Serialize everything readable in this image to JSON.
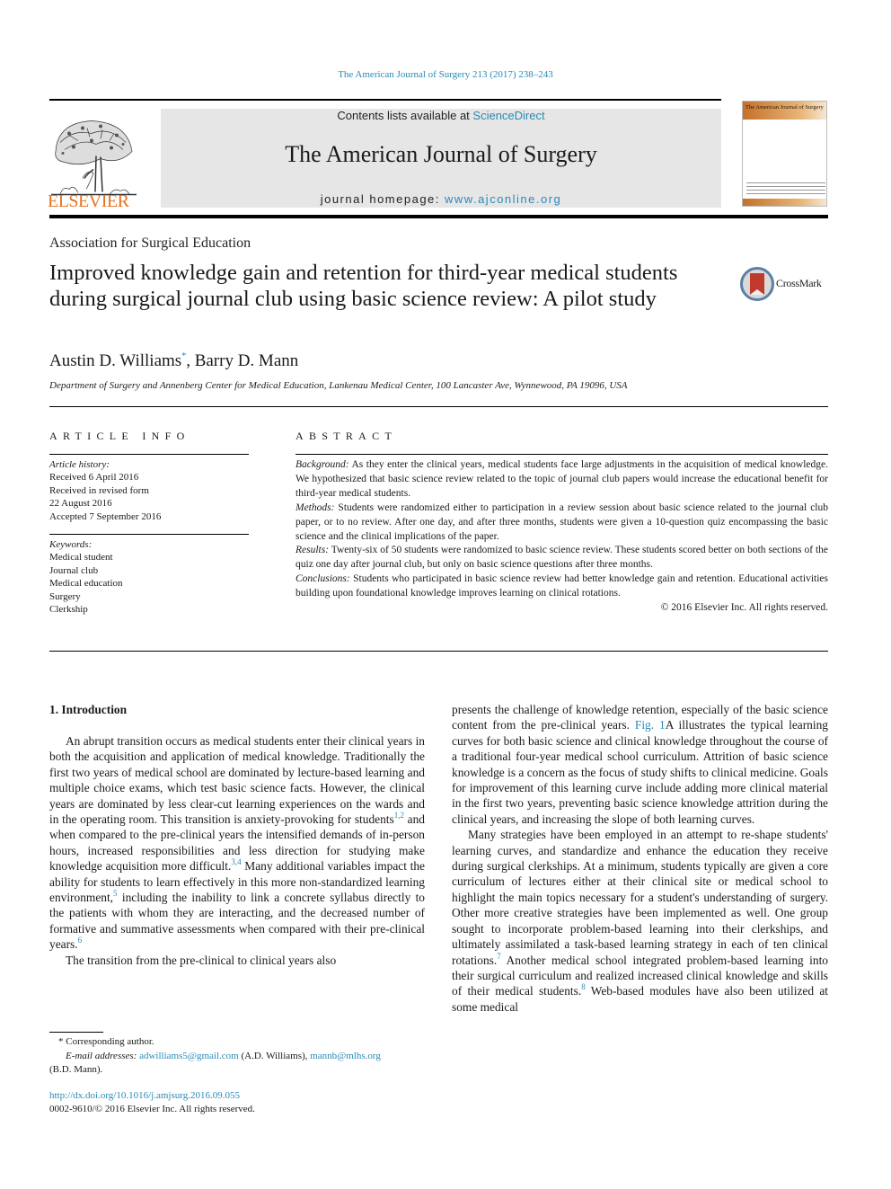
{
  "citation": "The American Journal of Surgery 213 (2017) 238–243",
  "masthead": {
    "publisher": "ELSEVIER",
    "contents_prefix": "Contents lists available at ",
    "contents_link": "ScienceDirect",
    "journal_name": "The American Journal of Surgery",
    "homepage_prefix": "journal homepage: ",
    "homepage_link": "www.ajconline.org",
    "cover_title": "The American Journal of Surgery"
  },
  "section_label": "Association for Surgical Education",
  "title": "Improved knowledge gain and retention for third-year medical students during surgical journal club using basic science review: A pilot study",
  "crossmark_label": "CrossMark",
  "authors": [
    {
      "name": "Austin D. Williams",
      "mark": "*"
    },
    {
      "name": "Barry D. Mann"
    }
  ],
  "affiliation": "Department of Surgery and Annenberg Center for Medical Education, Lankenau Medical Center, 100 Lancaster Ave, Wynnewood, PA 19096, USA",
  "article_info": {
    "heading": "ARTICLE INFO",
    "history_label": "Article history:",
    "history": [
      "Received 6 April 2016",
      "Received in revised form",
      "22 August 2016",
      "Accepted 7 September 2016"
    ],
    "keywords_label": "Keywords:",
    "keywords": [
      "Medical student",
      "Journal club",
      "Medical education",
      "Surgery",
      "Clerkship"
    ]
  },
  "abstract": {
    "heading": "ABSTRACT",
    "sections": [
      {
        "label": "Background:",
        "text": " As they enter the clinical years, medical students face large adjustments in the acquisition of medical knowledge. We hypothesized that basic science review related to the topic of journal club papers would increase the educational benefit for third-year medical students."
      },
      {
        "label": "Methods:",
        "text": " Students were randomized either to participation in a review session about basic science related to the journal club paper, or to no review. After one day, and after three months, students were given a 10-question quiz encompassing the basic science and the clinical implications of the paper."
      },
      {
        "label": "Results:",
        "text": " Twenty-six of 50 students were randomized to basic science review. These students scored better on both sections of the quiz one day after journal club, but only on basic science questions after three months."
      },
      {
        "label": "Conclusions:",
        "text": " Students who participated in basic science review had better knowledge gain and retention. Educational activities building upon foundational knowledge improves learning on clinical rotations."
      }
    ],
    "copyright": "© 2016 Elsevier Inc. All rights reserved."
  },
  "body": {
    "intro_heading": "1.  Introduction",
    "left": {
      "p1_a": "An abrupt transition occurs as medical students enter their clinical years in both the acquisition and application of medical knowledge. Traditionally the first two years of medical school are dominated by lecture-based learning and multiple choice exams, which test basic science facts. However, the clinical years are dominated by less clear-cut learning experiences on the wards and in the operating room. This transition is anxiety-provoking for students",
      "ref1": "1,2",
      "p1_b": " and when compared to the pre-clinical years the intensified demands of in-person hours, increased responsibilities and less direction for studying make knowledge acquisition more difficult.",
      "ref2": "3,4",
      "p1_c": " Many additional variables impact the ability for students to learn effectively in this more non-standardized learning environment,",
      "ref3": "5",
      "p1_d": " including the inability to link a concrete syllabus directly to the patients with whom they are interacting, and the decreased number of formative and summative assessments when compared with their pre-clinical years.",
      "ref4": "6",
      "p2": "The transition from the pre-clinical to clinical years also"
    },
    "right": {
      "p1_a": "presents the challenge of knowledge retention, especially of the basic science content from the pre-clinical years. ",
      "fig_link": "Fig. 1",
      "p1_b": "A illustrates the typical learning curves for both basic science and clinical knowledge throughout the course of a traditional four-year medical school curriculum. Attrition of basic science knowledge is a concern as the focus of study shifts to clinical medicine. Goals for improvement of this learning curve include adding more clinical material in the first two years, preventing basic science knowledge attrition during the clinical years, and increasing the slope of both learning curves.",
      "p2_a": "Many strategies have been employed in an attempt to re-shape students' learning curves, and standardize and enhance the education they receive during surgical clerkships. At a minimum, students typically are given a core curriculum of lectures either at their clinical site or medical school to highlight the main topics necessary for a student's understanding of surgery. Other more creative strategies have been implemented as well. One group sought to incorporate problem-based learning into their clerkships, and ultimately assimilated a task-based learning strategy in each of ten clinical rotations.",
      "ref7": "7",
      "p2_b": " Another medical school integrated problem-based learning into their surgical curriculum and realized increased clinical knowledge and skills of their medical students.",
      "ref8": "8",
      "p2_c": " Web-based modules have also been utilized at some medical"
    }
  },
  "footnote": {
    "corresponding": "* Corresponding author.",
    "email_label": "E-mail addresses:",
    "email1": "adwilliams5@gmail.com",
    "email1_owner": " (A.D. Williams), ",
    "email2": "mannb@mlhs.org",
    "email2_owner": "(B.D. Mann).",
    "doi": "http://dx.doi.org/10.1016/j.amjsurg.2016.09.055",
    "issn": "0002-9610/© 2016 Elsevier Inc. All rights reserved."
  },
  "colors": {
    "link": "#2a8ab5",
    "elsevier_orange": "#e8711e",
    "masthead_bg": "#e6e6e6"
  }
}
